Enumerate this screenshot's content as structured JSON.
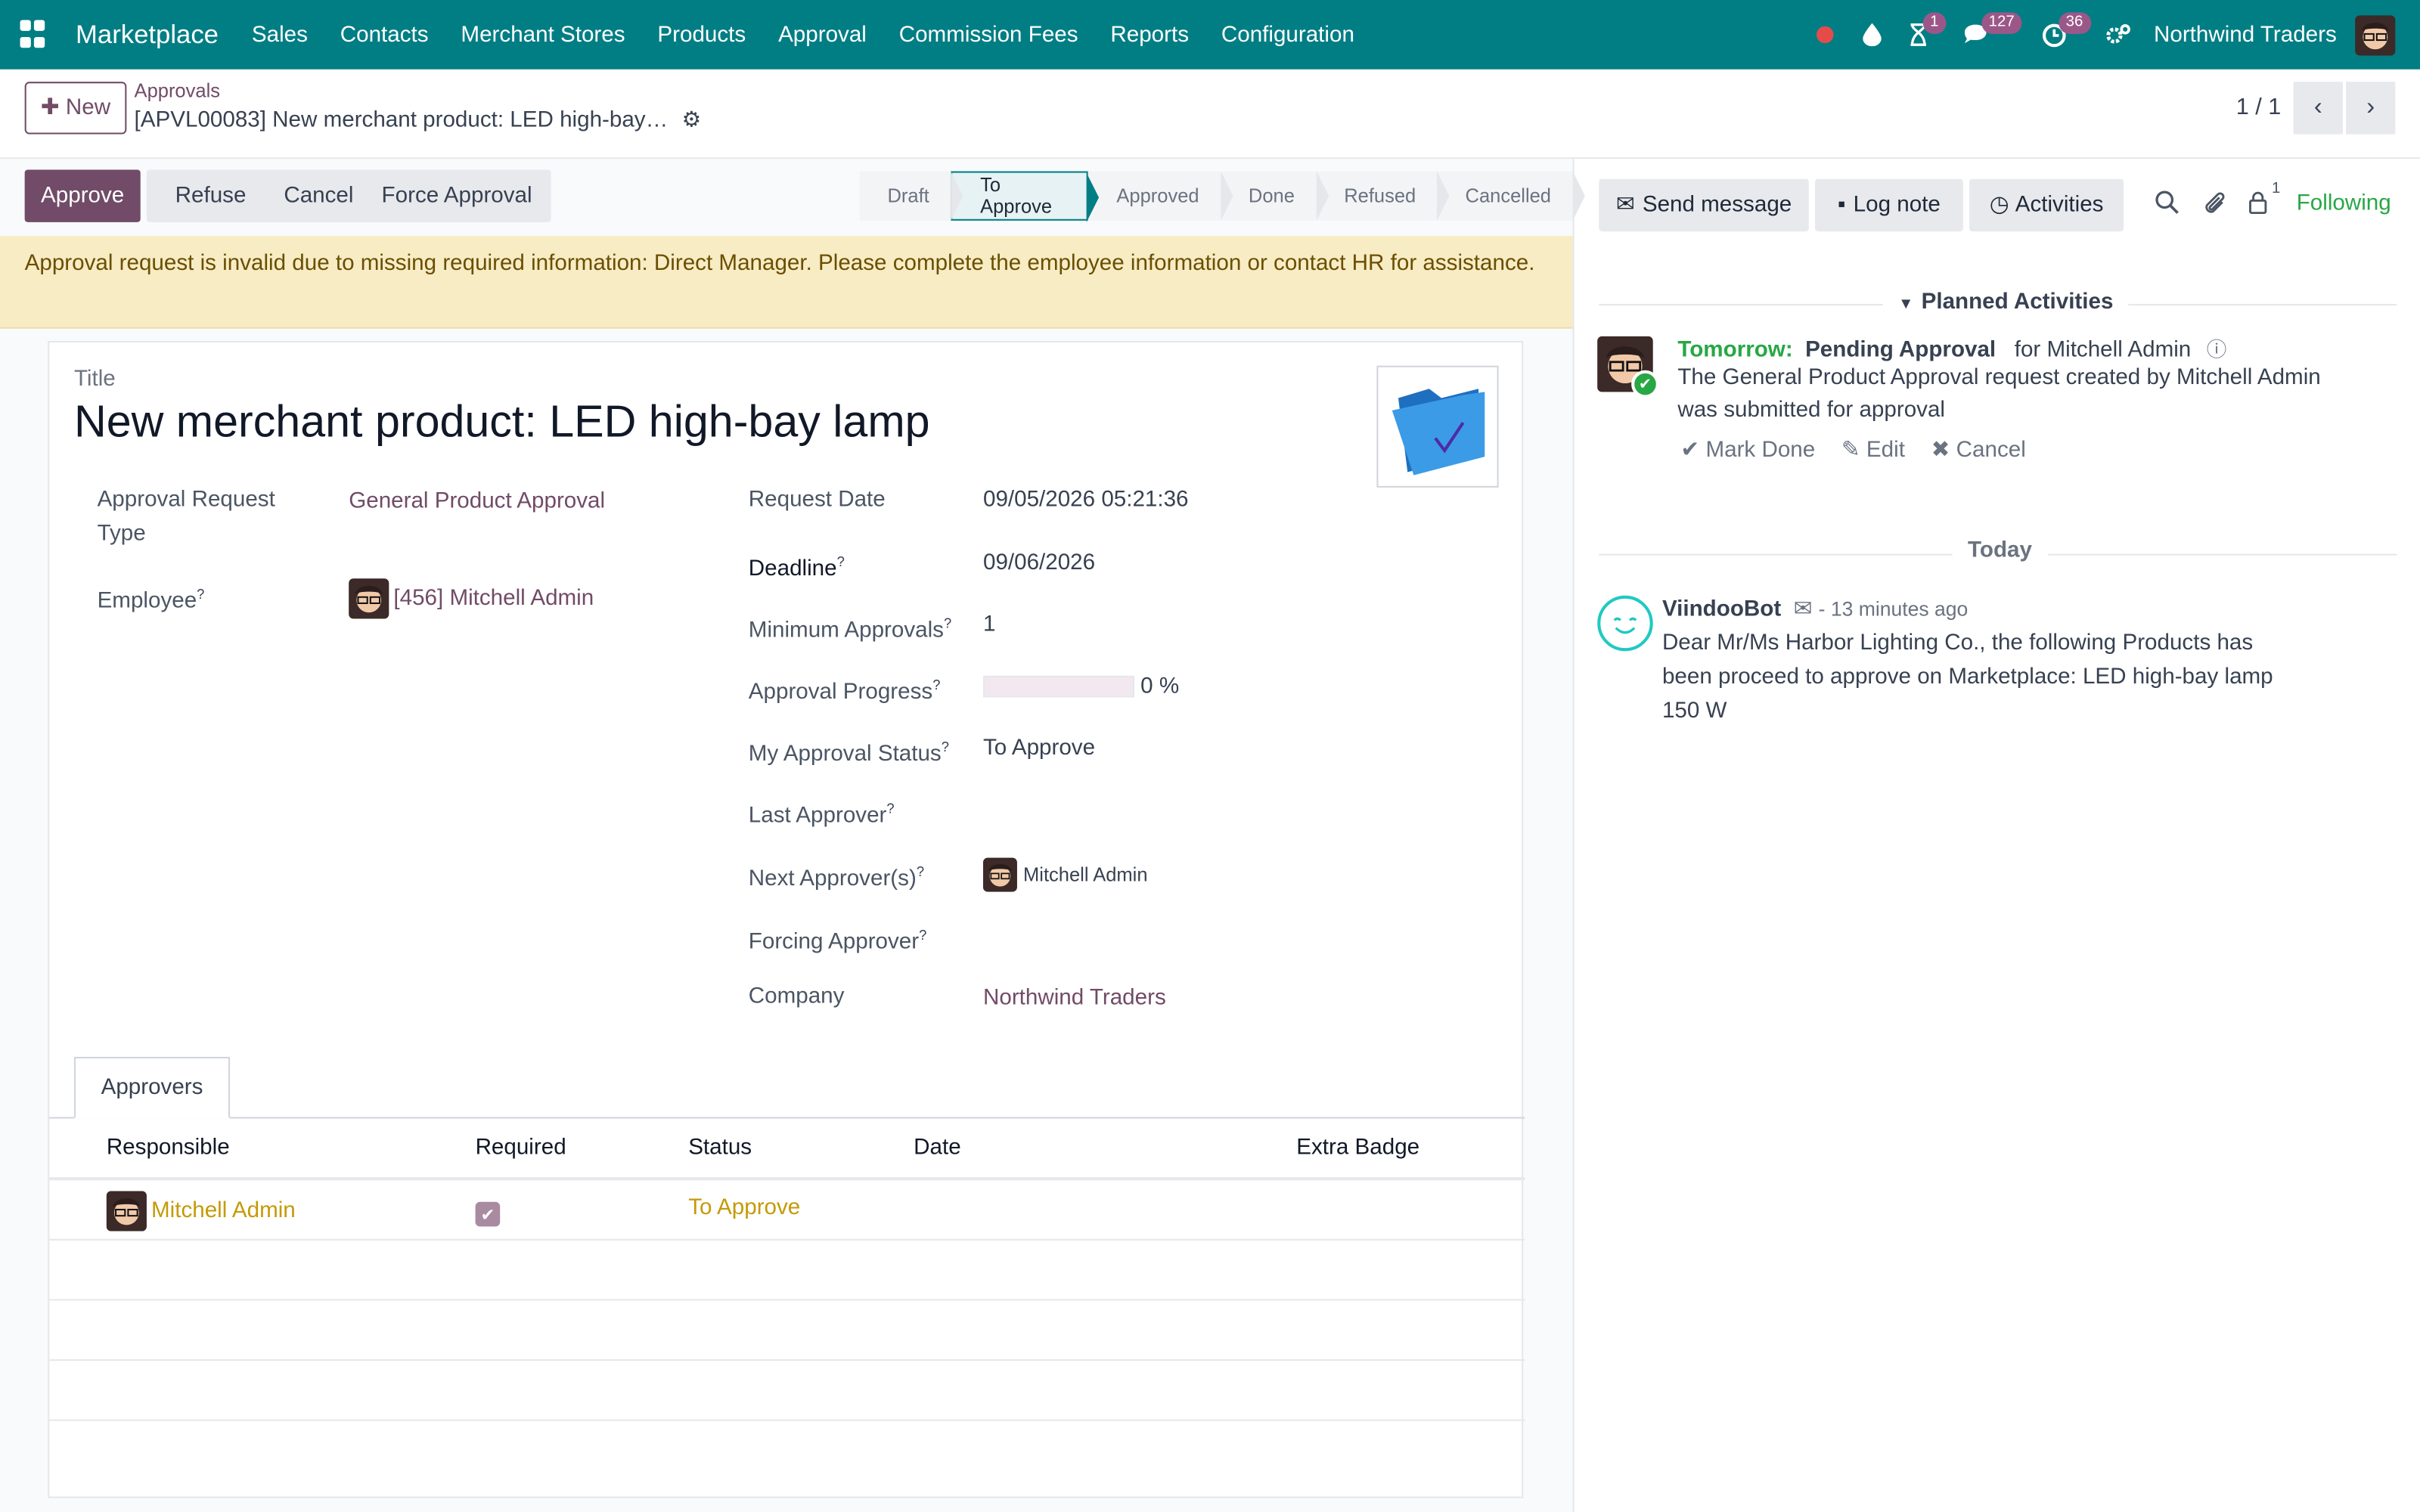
{
  "navbar": {
    "brand": "Marketplace",
    "menu": [
      "Sales",
      "Contacts",
      "Merchant Stores",
      "Products",
      "Approval",
      "Commission Fees",
      "Reports",
      "Configuration"
    ],
    "badges": {
      "activity": "1",
      "messages": "127",
      "clock": "36"
    },
    "company": "Northwind Traders"
  },
  "control_panel": {
    "new_label": "New",
    "breadcrumb_parent": "Approvals",
    "breadcrumb_current": "[APVL00083] New merchant product: LED high-bay…",
    "pager": "1 / 1"
  },
  "actions": {
    "approve": "Approve",
    "refuse": "Refuse",
    "cancel": "Cancel",
    "force": "Force Approval"
  },
  "stages": [
    "Draft",
    "To Approve",
    "Approved",
    "Done",
    "Refused",
    "Cancelled"
  ],
  "active_stage": "To Approve",
  "warning": "Approval request is invalid due to missing required information: Direct Manager. Please complete the employee information or contact HR for assistance.",
  "form": {
    "title_label": "Title",
    "title": "New merchant product: LED high-bay lamp",
    "type_label_1": "Approval Request",
    "type_label_2": "Type",
    "type_value": "General Product Approval",
    "employee_label": "Employee",
    "employee_value": "[456] Mitchell Admin",
    "request_date_label": "Request Date",
    "request_date": "09/05/2026 05:21:36",
    "deadline_label": "Deadline",
    "deadline": "09/06/2026",
    "min_approvals_label": "Minimum Approvals",
    "min_approvals": "1",
    "progress_label": "Approval Progress",
    "progress_value": 0,
    "progress_text": "0 %",
    "my_status_label": "My Approval Status",
    "my_status": "To Approve",
    "last_approver_label": "Last Approver",
    "next_approver_label": "Next Approver(s)",
    "next_approver": "Mitchell Admin",
    "forcing_approver_label": "Forcing Approver",
    "company_label": "Company",
    "company": "Northwind Traders",
    "tooltip_mark": "?"
  },
  "approvers": {
    "tab": "Approvers",
    "columns": [
      "Responsible",
      "Required",
      "Status",
      "Date",
      "Extra Badge"
    ],
    "rows": [
      {
        "responsible": "Mitchell Admin",
        "required": true,
        "status": "To Approve",
        "date": "",
        "extra": ""
      }
    ]
  },
  "chatter": {
    "send_message": "Send message",
    "log_note": "Log note",
    "activities": "Activities",
    "followers_count": "1",
    "following": "Following",
    "planned_label": "Planned Activities",
    "activity": {
      "when": "Tomorrow:",
      "type": "Pending Approval",
      "for": "for Mitchell Admin",
      "line1": "The General Product Approval request created by Mitchell Admin",
      "line2": "was submitted for approval",
      "mark_done": "Mark Done",
      "edit": "Edit",
      "cancel": "Cancel"
    },
    "today_label": "Today",
    "message": {
      "author": "ViindooBot",
      "time": "- 13 minutes ago",
      "line1": "Dear Mr/Ms Harbor Lighting Co., the following Products has",
      "line2": "been proceed to approve on Marketplace: LED high-bay lamp",
      "line3": "150 W"
    }
  }
}
